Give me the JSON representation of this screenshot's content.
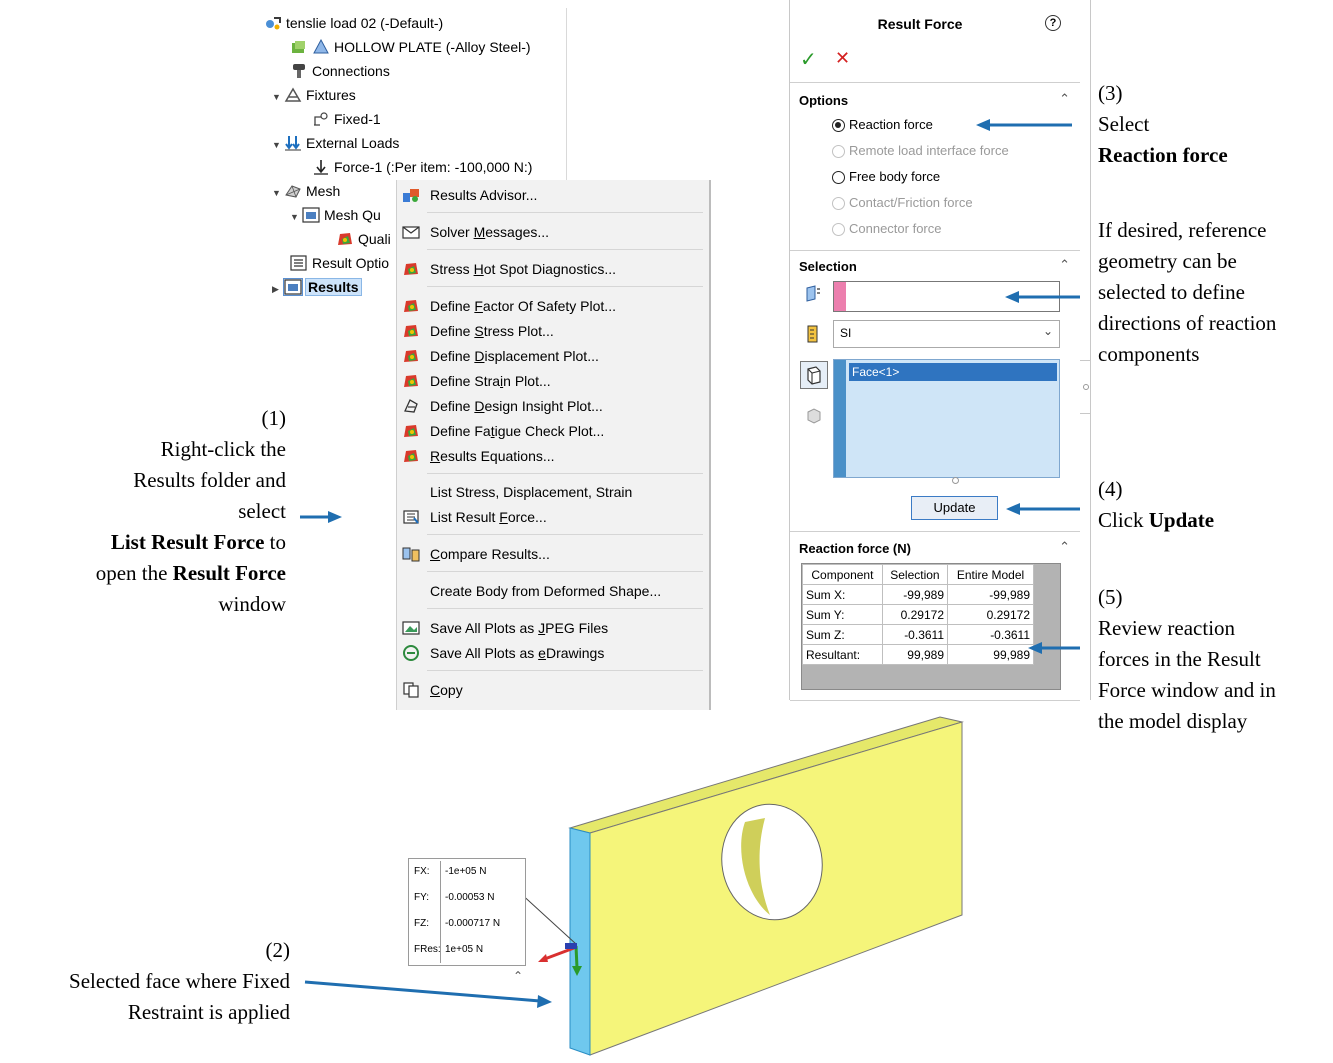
{
  "tree": {
    "rows": [
      {
        "label": "tenslie load 02 (-Default-)",
        "icon": "study-icon"
      },
      {
        "label": "HOLLOW PLATE (-Alloy Steel-)",
        "icon": "part-icon"
      },
      {
        "label": "Connections",
        "icon": "connections-icon"
      },
      {
        "label": "Fixtures",
        "icon": "fixtures-icon"
      },
      {
        "label": "Fixed-1",
        "icon": "fixed-icon"
      },
      {
        "label": "External Loads",
        "icon": "external-loads-icon"
      },
      {
        "label": "Force-1 (:Per item: -100,000 N:)",
        "icon": "force-icon"
      },
      {
        "label": "Mesh",
        "icon": "mesh-icon"
      },
      {
        "label": "Mesh Qu",
        "icon": "mesh-quality-icon"
      },
      {
        "label": "Quali",
        "icon": "quality-plot-icon"
      },
      {
        "label": "Result Optio",
        "icon": "result-options-icon"
      },
      {
        "label": "Results",
        "icon": "results-folder-icon"
      }
    ]
  },
  "menu": {
    "results_advisor": [
      "Results Advisor..."
    ],
    "solver_messages": [
      "Solver ",
      "M",
      "essages..."
    ],
    "hot_spot": [
      "Stress ",
      "H",
      "ot Spot Diagnostics..."
    ],
    "factor_of_safety": [
      "Define ",
      "F",
      "actor Of Safety Plot..."
    ],
    "stress_plot": [
      "Define ",
      "S",
      "tress Plot..."
    ],
    "displacement_plot": [
      "Define ",
      "D",
      "isplacement Plot..."
    ],
    "strain_plot": [
      "Define Stra",
      "i",
      "n Plot..."
    ],
    "design_insight": [
      "Define ",
      "D",
      "esign Insight Plot..."
    ],
    "fatigue_check": [
      "Define Fa",
      "t",
      "igue Check Plot..."
    ],
    "results_equations": [
      "",
      "R",
      "esults Equations..."
    ],
    "list_stress": [
      "List Stress, Displacement, Strain"
    ],
    "list_result_force": [
      "List Result ",
      "F",
      "orce..."
    ],
    "compare_results": [
      "",
      "C",
      "ompare Results..."
    ],
    "create_body": [
      "Create Body from Deformed Shape..."
    ],
    "save_jpeg": [
      "Save All Plots as ",
      "J",
      "PEG Files"
    ],
    "save_edrawings": [
      "Save All Plots as ",
      "e",
      "Drawings"
    ],
    "copy": [
      "",
      "C",
      "opy"
    ]
  },
  "panel": {
    "title": "Result Force",
    "options_header": "Options",
    "options": [
      {
        "label": "Reaction force",
        "selected": true,
        "enabled": true
      },
      {
        "label": "Remote load interface force",
        "selected": false,
        "enabled": false
      },
      {
        "label": "Free body force",
        "selected": false,
        "enabled": true
      },
      {
        "label": "Contact/Friction force",
        "selected": false,
        "enabled": false
      },
      {
        "label": "Connector force",
        "selected": false,
        "enabled": false
      }
    ],
    "selection_header": "Selection",
    "reference_value": "",
    "units_value": "SI",
    "selected_faces": [
      "Face<1>"
    ],
    "update_label": "Update",
    "reaction_header": "Reaction force (N)",
    "table": {
      "columns": [
        "Component",
        "Selection",
        "Entire Model"
      ],
      "rows": [
        [
          "Sum X:",
          "-99,989",
          "-99,989"
        ],
        [
          "Sum Y:",
          "0.29172",
          "0.29172"
        ],
        [
          "Sum Z:",
          "-0.3611",
          "-0.3611"
        ],
        [
          "Resultant:",
          "99,989",
          "99,989"
        ]
      ]
    }
  },
  "annotations": {
    "a1": {
      "num": "(1)",
      "l1": "Right-click the",
      "l2": "Results folder and",
      "l3": "select",
      "l4b": "List Result Force",
      "l4": " to",
      "l5a": "open the ",
      "l5b": "Result Force",
      "l6": "window"
    },
    "a2": {
      "num": "(2)",
      "l1": "Selected face where Fixed",
      "l2": "Restraint is applied"
    },
    "a3": {
      "num": "(3)",
      "l1": "Select",
      "l2b": "Reaction force"
    },
    "ref": {
      "l1": "If desired, reference",
      "l2": "geometry can be",
      "l3": "selected to define",
      "l4": "directions of reaction",
      "l5": "components"
    },
    "a4": {
      "num": "(4)",
      "l1": "Click ",
      "l1b": "Update"
    },
    "a5": {
      "num": "(5)",
      "l1": "Review reaction",
      "l2": "forces in the Result",
      "l3": "Force window and in",
      "l4": "the model display"
    }
  },
  "callout": {
    "rows": [
      {
        "key": "FX:",
        "value": "-1e+05 N"
      },
      {
        "key": "FY:",
        "value": "-0.00053 N"
      },
      {
        "key": "FZ:",
        "value": "-0.000717 N"
      },
      {
        "key": "FRes:",
        "value": "1e+05 N"
      }
    ]
  },
  "colors": {
    "plate": "#f5f57a",
    "plate_top": "#e8ea6a",
    "selected_face": "#6fc8ee",
    "arrow": "#1f6eb0",
    "selection_box": "#cfe5f7",
    "selection_strip": "#4a90c8"
  }
}
